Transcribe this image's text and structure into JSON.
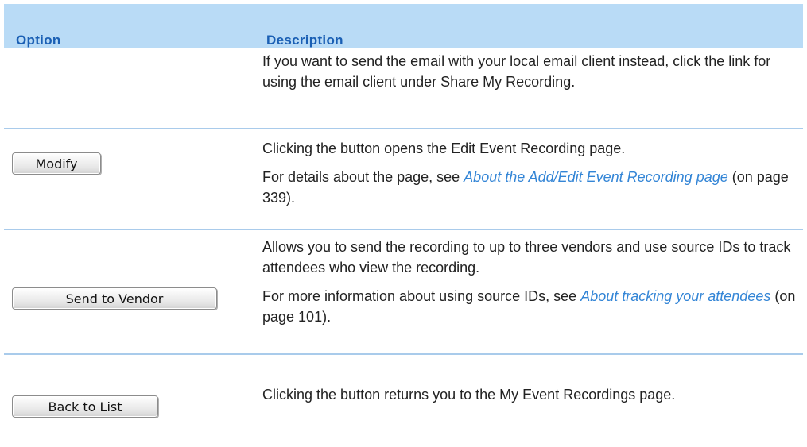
{
  "header": {
    "option_label": "Option",
    "description_label": "Description"
  },
  "rows": [
    {
      "lines": [
        "If you want to send the email with your local email client instead, click the link for using the email client under Share My Recording."
      ]
    },
    {
      "button": "Modify",
      "text1": "Clicking the button opens the Edit Event Recording page.",
      "text2_before": "For details about the page, see ",
      "text2_link": "About the Add/Edit Event Recording page",
      "text2_after": " (on page 339)."
    },
    {
      "button": "Send to Vendor",
      "text1": "Allows you to send the recording to up to three vendors and use source IDs to track attendees who view the recording.",
      "text2_before": "For more information about using source IDs, see ",
      "text2_link": "About tracking your attendees",
      "text2_after": " (on page 101)."
    },
    {
      "button": "Back to List",
      "text1": "Clicking the button returns you to the My Event Recordings page."
    }
  ],
  "colors": {
    "header_bg": "#b9dbf6",
    "header_text": "#1a5fb4",
    "link": "#3385d6",
    "separator": "#a9cbeb"
  }
}
